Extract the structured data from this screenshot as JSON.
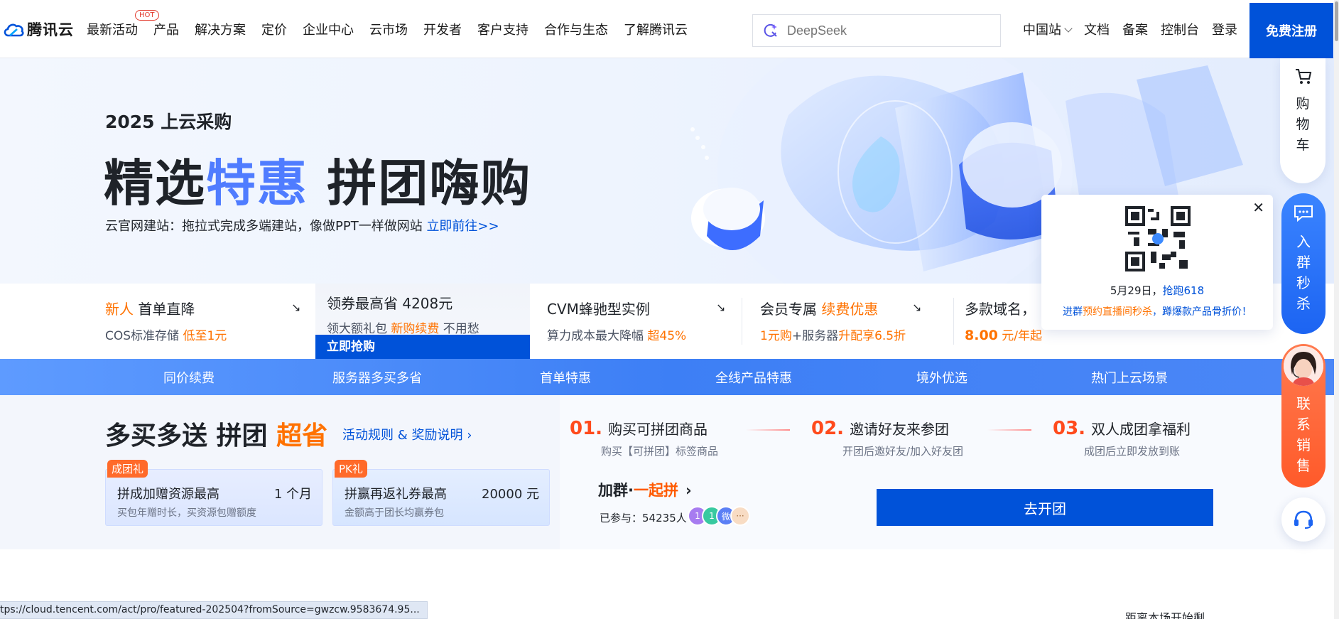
{
  "brand": {
    "name": "腾讯云"
  },
  "nav": {
    "items": [
      "最新活动",
      "产品",
      "解决方案",
      "定价",
      "企业中心",
      "云市场",
      "开发者",
      "客户支持",
      "合作与生态",
      "了解腾讯云"
    ],
    "hot_badge": "HOT"
  },
  "search": {
    "placeholder": "DeepSeek"
  },
  "right_nav": {
    "region": "中国站",
    "docs": "文档",
    "beian": "备案",
    "console": "控制台",
    "login": "登录",
    "register": "免费注册"
  },
  "hero": {
    "subtitle": "2025 上云采购",
    "title_part1": "精选",
    "title_part2": "特惠",
    "title_part3": " 拼团嗨购",
    "desc": "云官网建站：拖拉式完成多端建站，像做PPT一样做网站 ",
    "desc_link": "立即前往>>"
  },
  "promo": [
    {
      "hl": "新人",
      "title": " 首单直降",
      "line2": "COS标准存储 ",
      "line2_hl": "低至1元"
    },
    {
      "title": "领券最高省 4208元",
      "line2": "领大额礼包 ",
      "line2_hl": "新购续费",
      "line2_tail": " 不用愁",
      "button": "立即抢购"
    },
    {
      "title": "CVM蜂驰型实例",
      "line2": "算力成本最大降幅 ",
      "line2_hl": "超45%"
    },
    {
      "title": "会员专属 ",
      "title_hl": "续费优惠",
      "line2_hl": "1元购",
      "line2": "+服务器",
      "line2_hl2": "升配享6.5折"
    },
    {
      "title": "多款域名，",
      "line2_hl": "8.00",
      "line2": " 元/年起"
    }
  ],
  "tabs": [
    "同价续费",
    "服务器多买多省",
    "首单特惠",
    "全线产品特惠",
    "境外优选",
    "热门上云场景"
  ],
  "group": {
    "title_main": "多买多送 拼团 ",
    "title_hl": "超省",
    "rules": "活动规则 & 奖励说明 ›",
    "gifts": [
      {
        "tag": "成团礼",
        "name": "拼成加赠资源最高",
        "value": "1 个月",
        "note": "买包年赠时长，买资源包赠额度"
      },
      {
        "tag": "PK礼",
        "name": "拼赢再返礼券最高",
        "value": "20000 元",
        "note": "金额高于团长均赢券包"
      }
    ],
    "steps": [
      {
        "num": "01.",
        "title": "购买可拼团商品",
        "note": "购买【可拼团】标签商品"
      },
      {
        "num": "02.",
        "title": "邀请好友来参团",
        "note": "开团后邀好友/加入好友团"
      },
      {
        "num": "03.",
        "title": "双人成团拿福利",
        "note": "成团后立即发放到账"
      }
    ],
    "join_title": "加群·",
    "join_title_hl": "一起拼",
    "joined_label": "已参与：",
    "joined_count": "54235人",
    "avatars": [
      "1",
      "1",
      "微",
      "···"
    ],
    "open_button": "去开团"
  },
  "popup": {
    "date": "5月29日，",
    "date_link": "抢跑618",
    "desc_1": "进群",
    "desc_hl": "预约直播间秒杀",
    "desc_2": "，蹲爆款产品骨折价！"
  },
  "sidebar": {
    "cart": [
      "购",
      "物",
      "车"
    ],
    "qun": [
      "入",
      "群",
      "秒",
      "杀"
    ],
    "sales": [
      "联",
      "系",
      "销",
      "售"
    ]
  },
  "statusbar": {
    "url": "tps://cloud.tencent.com/act/pro/featured-202504?fromSource=gwzcw.9583674.95..."
  },
  "bottom_right": "距离本场开始剩",
  "colors": {
    "primary": "#0052d9",
    "accent_orange": "#ff7200",
    "step_red": "#ff4a1c"
  }
}
